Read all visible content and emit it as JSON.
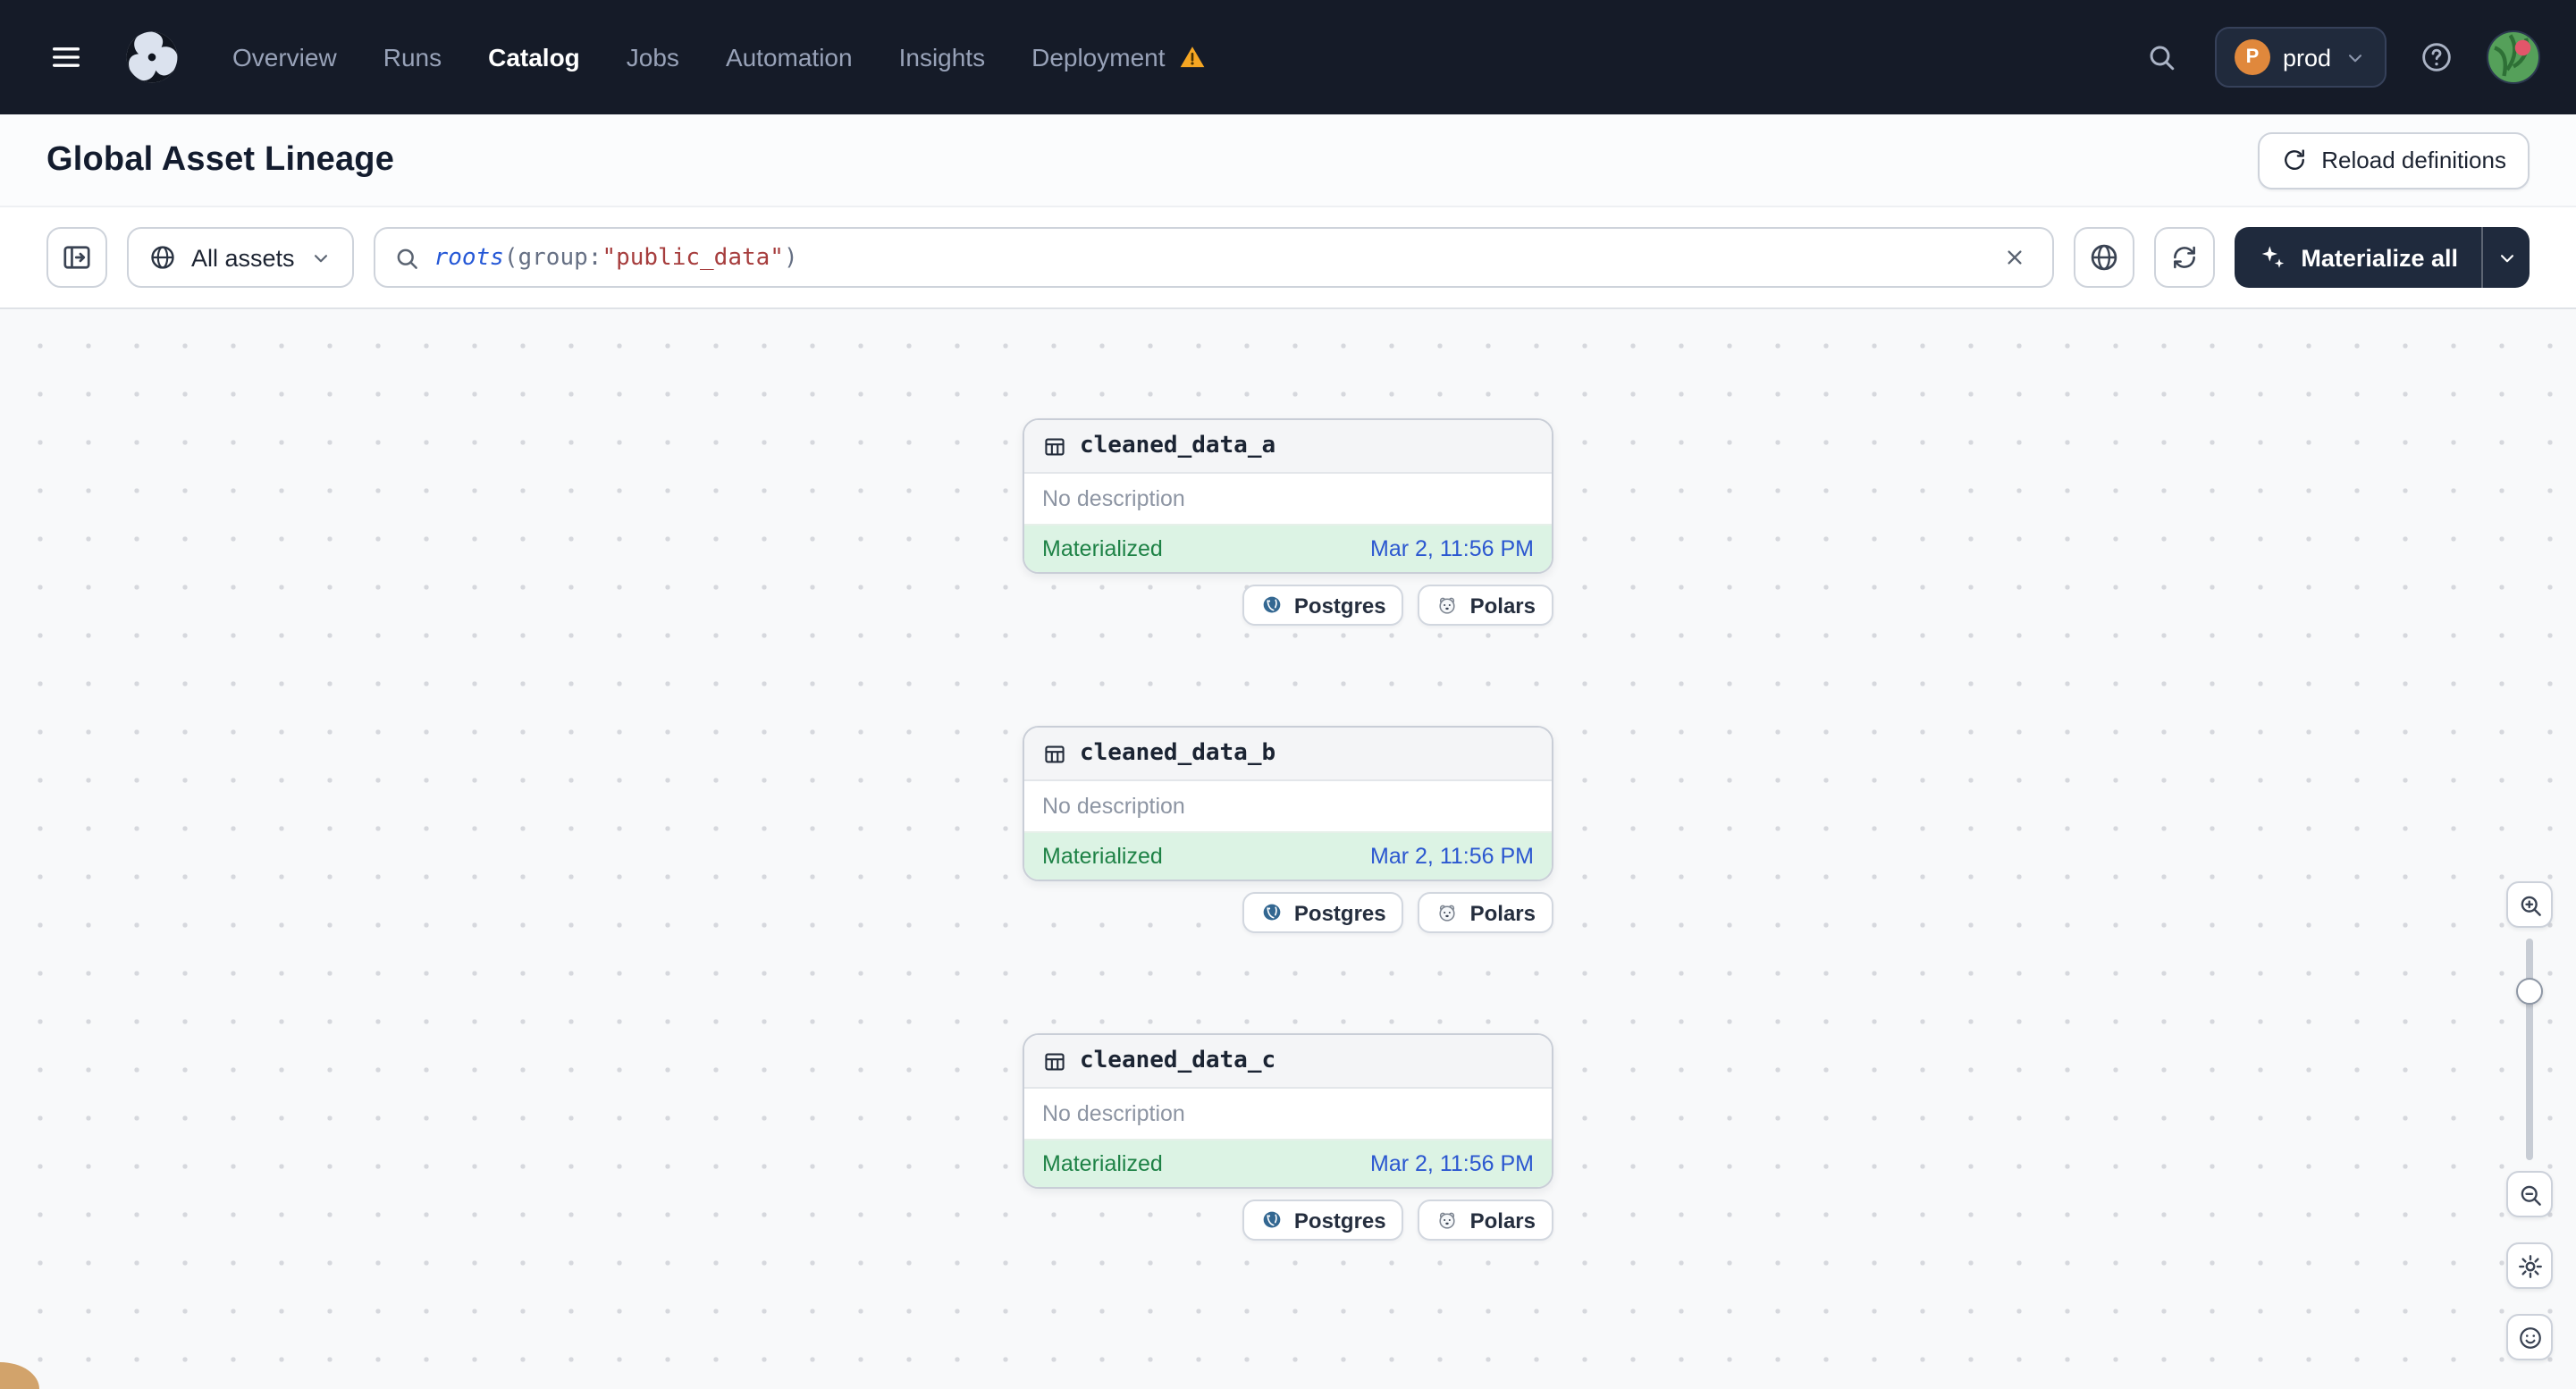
{
  "nav": {
    "items": [
      {
        "label": "Overview"
      },
      {
        "label": "Runs"
      },
      {
        "label": "Catalog"
      },
      {
        "label": "Jobs"
      },
      {
        "label": "Automation"
      },
      {
        "label": "Insights"
      },
      {
        "label": "Deployment"
      }
    ],
    "environment": {
      "initial": "P",
      "name": "prod"
    }
  },
  "header": {
    "title": "Global Asset Lineage",
    "reload_definitions_label": "Reload definitions"
  },
  "toolbar": {
    "asset_scope_label": "All assets",
    "query": {
      "function": "roots",
      "open_paren": "(",
      "attribute": "group:",
      "value": "\"public_data\"",
      "close_paren": ")"
    },
    "materialize_all_label": "Materialize all"
  },
  "graph": {
    "nodes": [
      {
        "name": "cleaned_data_a",
        "description": "No description",
        "status": "Materialized",
        "materialized_at": "Mar 2, 11:56 PM",
        "tags": [
          {
            "label": "Postgres"
          },
          {
            "label": "Polars"
          }
        ]
      },
      {
        "name": "cleaned_data_b",
        "description": "No description",
        "status": "Materialized",
        "materialized_at": "Mar 2, 11:56 PM",
        "tags": [
          {
            "label": "Postgres"
          },
          {
            "label": "Polars"
          }
        ]
      },
      {
        "name": "cleaned_data_c",
        "description": "No description",
        "status": "Materialized",
        "materialized_at": "Mar 2, 11:56 PM",
        "tags": [
          {
            "label": "Postgres"
          },
          {
            "label": "Polars"
          }
        ]
      }
    ]
  },
  "colors": {
    "nav_background": "#151b28",
    "accent_dark": "#1f2a3d",
    "materialized_green": "#1e8246",
    "materialized_bg": "#dcf3e4",
    "timestamp_blue": "#2b57d0",
    "warning_amber": "#f5a623",
    "env_badge": "#e0883c"
  }
}
